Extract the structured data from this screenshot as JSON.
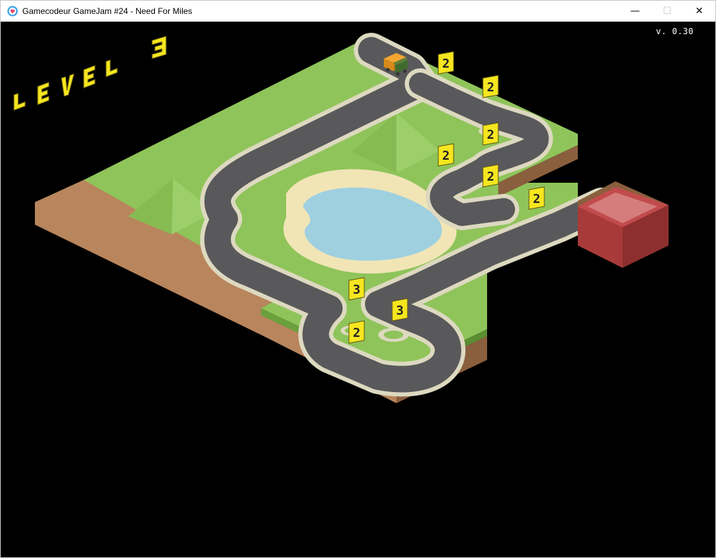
{
  "window": {
    "title": "Gamecodeur GameJam #24 - Need For Miles",
    "icon": "heart-in-circle-icon",
    "controls": [
      "minimize-icon",
      "maximize-icon",
      "close-icon"
    ]
  },
  "game": {
    "version": "v. 0.30",
    "level_letters": [
      "L",
      "E",
      "V",
      "E",
      "L",
      "3"
    ],
    "level_number": 3,
    "vehicle": "delivery-truck",
    "finish_zone": "red-goal-pad",
    "track_markers": [
      "2",
      "2",
      "2",
      "2",
      "2",
      "2",
      "3",
      "3",
      "2"
    ],
    "colors": {
      "grass": "#8fc45a",
      "dirt": "#b9855c",
      "road": "#59595b",
      "curb": "#ddd9c0",
      "water": "#9fd0e0",
      "sand": "#f1e5b6",
      "marker": "#f6e61f",
      "goal": "#c24b4b"
    }
  }
}
